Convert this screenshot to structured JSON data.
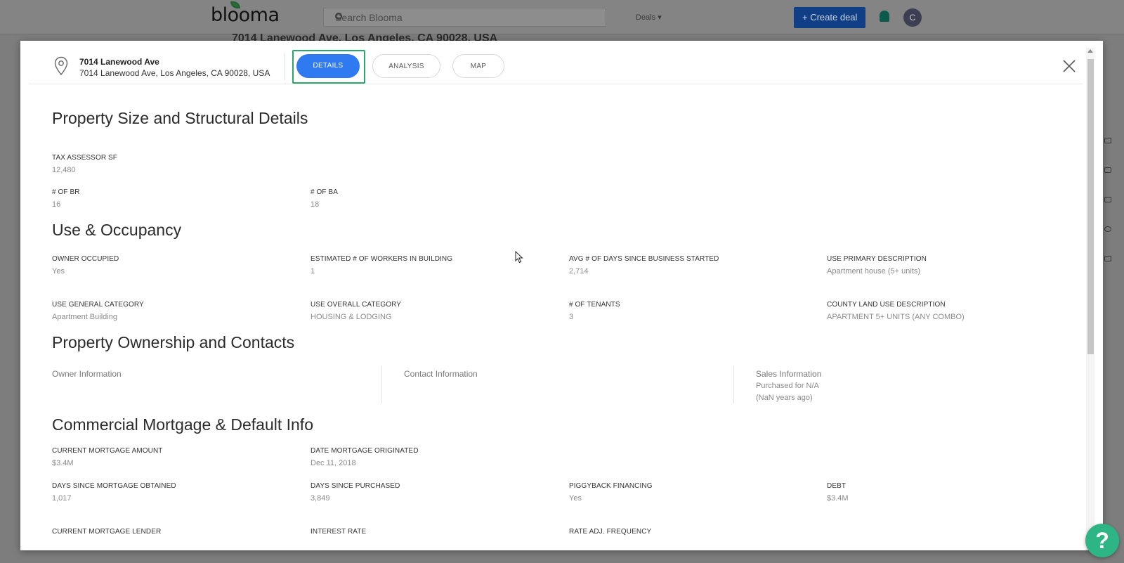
{
  "background": {
    "logo": "blooma",
    "search_placeholder": "Search Blooma",
    "deals_label": "Deals",
    "create_deal_label": "Create deal",
    "avatar_initial": "C",
    "page_title": "7014 Lanewood Ave, Los Angeles, CA 90028, USA"
  },
  "modal": {
    "address_title": "7014 Lanewood Ave",
    "address_full": "7014 Lanewood Ave, Los Angeles, CA 90028, USA",
    "tabs": [
      {
        "label": "DETAILS",
        "active": true
      },
      {
        "label": "ANALYSIS",
        "active": false
      },
      {
        "label": "MAP",
        "active": false
      }
    ],
    "active_tab_color": "#2f7af1",
    "highlight_color": "#2aa86a"
  },
  "sections": {
    "structural": {
      "title": "Property Size and Structural Details",
      "tax_assessor_sf": {
        "label": "TAX ASSESSOR SF",
        "value": "12,480"
      },
      "num_br": {
        "label": "# OF BR",
        "value": "16"
      },
      "num_ba": {
        "label": "# OF BA",
        "value": "18"
      }
    },
    "occupancy": {
      "title": "Use & Occupancy",
      "owner_occupied": {
        "label": "OWNER OCCUPIED",
        "value": "Yes"
      },
      "workers": {
        "label": "ESTIMATED # OF WORKERS IN BUILDING",
        "value": "1"
      },
      "avg_days": {
        "label": "AVG # OF DAYS SINCE BUSINESS STARTED",
        "value": "2,714"
      },
      "use_primary": {
        "label": "USE PRIMARY DESCRIPTION",
        "value": "Apartment house (5+ units)"
      },
      "use_general": {
        "label": "USE GENERAL CATEGORY",
        "value": "Apartment Building"
      },
      "use_overall": {
        "label": "USE OVERALL CATEGORY",
        "value": "HOUSING & LODGING"
      },
      "tenants": {
        "label": "# OF TENANTS",
        "value": "3"
      },
      "county_land": {
        "label": "COUNTY LAND USE DESCRIPTION",
        "value": "APARTMENT 5+ UNITS (ANY COMBO)"
      }
    },
    "ownership": {
      "title": "Property Ownership and Contacts",
      "owner_info": "Owner Information",
      "contact_info": "Contact Information",
      "sales_info": "Sales Information",
      "purchased_for": "Purchased for N/A",
      "years_ago": "(NaN years ago)"
    },
    "mortgage": {
      "title": "Commercial Mortgage & Default Info",
      "current_amount": {
        "label": "CURRENT MORTGAGE AMOUNT",
        "value": "$3.4M"
      },
      "date_originated": {
        "label": "DATE MORTGAGE ORIGINATED",
        "value": "Dec 11, 2018"
      },
      "days_obtained": {
        "label": "DAYS SINCE MORTGAGE OBTAINED",
        "value": "1,017"
      },
      "days_purchased": {
        "label": "DAYS SINCE PURCHASED",
        "value": "3,849"
      },
      "piggyback": {
        "label": "PIGGYBACK FINANCING",
        "value": "Yes"
      },
      "debt": {
        "label": "DEBT",
        "value": "$3.4M"
      },
      "lender": {
        "label": "CURRENT MORTGAGE LENDER"
      },
      "interest_rate": {
        "label": "INTEREST RATE"
      },
      "rate_adj": {
        "label": "RATE ADJ. FREQUENCY"
      }
    }
  },
  "help_label": "?"
}
